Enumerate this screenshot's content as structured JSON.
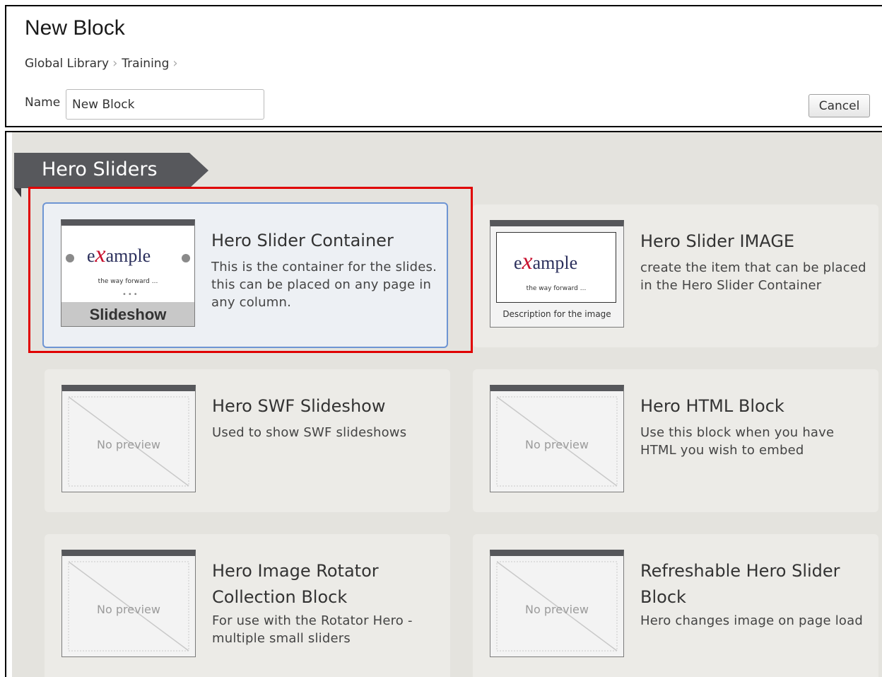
{
  "header": {
    "title": "New Block",
    "breadcrumb": [
      "Global Library",
      "Training"
    ],
    "name_label": "Name",
    "name_value": "New Block",
    "cancel_label": "Cancel"
  },
  "section": {
    "title": "Hero Sliders"
  },
  "cards": [
    {
      "title": "Hero Slider Container",
      "description": "This is the container for the slides. this can be placed on any page in any column.",
      "thumb": "slideshow",
      "logo": "example",
      "tagline": "the way forward ...",
      "thumb_label": "Slideshow",
      "selected": true
    },
    {
      "title": "Hero Slider IMAGE",
      "description": "create the item that can be placed in the Hero Slider Container",
      "thumb": "image",
      "logo": "example",
      "tagline": "the way forward ...",
      "thumb_label": "Description for the image",
      "selected": false
    },
    {
      "title": "Hero SWF Slideshow",
      "description": "Used to show SWF slideshows",
      "thumb": "none",
      "thumb_label": "No preview",
      "selected": false
    },
    {
      "title": "Hero HTML Block",
      "description": "Use this block when you have HTML you wish to embed",
      "thumb": "none",
      "thumb_label": "No preview",
      "selected": false
    },
    {
      "title": "Hero Image Rotator Collection Block",
      "description": "For use with the Rotator Hero - multiple small sliders",
      "thumb": "none",
      "thumb_label": "No preview",
      "selected": false
    },
    {
      "title": "Refreshable Hero Slider Block",
      "description": "Hero changes image on page load",
      "thumb": "none",
      "thumb_label": "No preview",
      "selected": false
    }
  ],
  "colors": {
    "selection_border": "#6e95d3",
    "highlight": "#e00000",
    "tab_background": "#57585c",
    "logo_x": "#c8102e"
  }
}
